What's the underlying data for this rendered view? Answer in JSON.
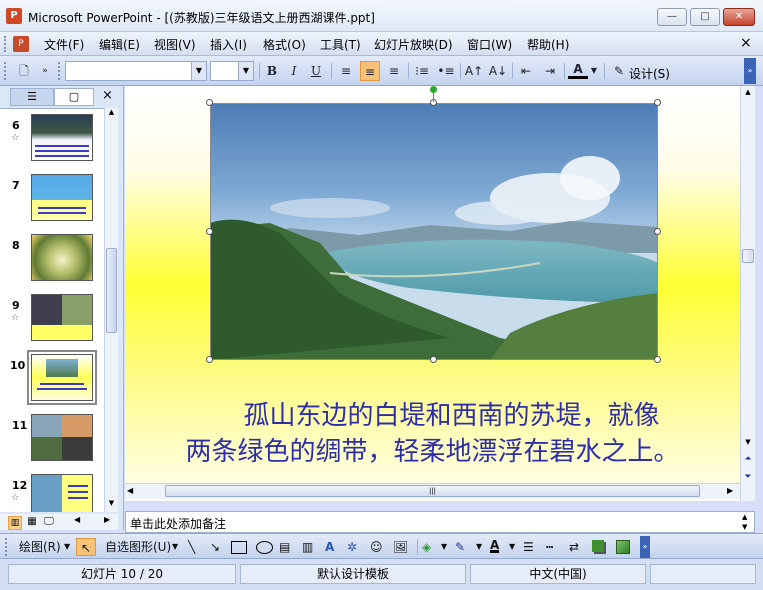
{
  "window": {
    "title": "Microsoft PowerPoint - [(苏教版)三年级语文上册西湖课件.ppt]",
    "app_icon_letter": "P",
    "minimize": "—",
    "maximize": "□",
    "close": "✕"
  },
  "menu": {
    "items": [
      "文件(F)",
      "编辑(E)",
      "视图(V)",
      "插入(I)",
      "格式(O)",
      "工具(T)",
      "幻灯片放映(D)",
      "窗口(W)",
      "帮助(H)"
    ],
    "close": "×"
  },
  "toolbar": {
    "font_name": "",
    "font_size": "",
    "bold": "B",
    "italic": "I",
    "underline": "U",
    "design_label": "设计(S)"
  },
  "left_pane": {
    "tab_outline_icon": "outline-icon",
    "tab_slides_icon": "slides-icon",
    "close": "×",
    "slides": [
      {
        "num": "6",
        "star": "☆"
      },
      {
        "num": "7",
        "star": ""
      },
      {
        "num": "8",
        "star": ""
      },
      {
        "num": "9",
        "star": "☆"
      },
      {
        "num": "10",
        "star": ""
      },
      {
        "num": "11",
        "star": ""
      },
      {
        "num": "12",
        "star": "☆"
      }
    ]
  },
  "slide": {
    "line1": "孤山东边的白堤和西南的苏堤，就像",
    "line2": "两条绿色的绸带，轻柔地漂浮在碧水之上。"
  },
  "notes": {
    "placeholder": "单击此处添加备注"
  },
  "drawbar": {
    "draw_label": "绘图(R)",
    "autoshape_label": "自选图形(U)"
  },
  "status": {
    "slide_info": "幻灯片 10 / 20",
    "template": "默认设计模板",
    "language": "中文(中国)"
  },
  "colors": {
    "slide_text": "#2d2fa8",
    "accent": "#d24726"
  }
}
